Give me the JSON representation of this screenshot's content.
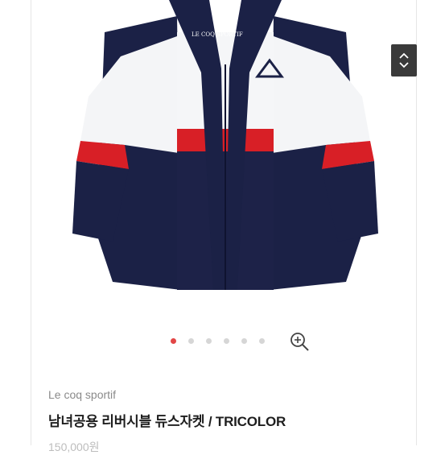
{
  "product": {
    "brand": "Le coq sportif",
    "name": "남녀공용 리버시블 듀스자켓 / TRICOLOR",
    "price_partial": "150,000원",
    "image_logo_text": "LE COQ SPORTIF"
  },
  "gallery": {
    "image_count": 6,
    "active_index": 0
  },
  "icons": {
    "scroll": "chevron-up-down-icon",
    "zoom": "zoom-in-icon"
  },
  "colors": {
    "navy": "#1c2147",
    "white": "#f7f7f8",
    "red": "#d81f26",
    "active_dot": "#e24646",
    "inactive_dot": "#d6d6d6"
  }
}
